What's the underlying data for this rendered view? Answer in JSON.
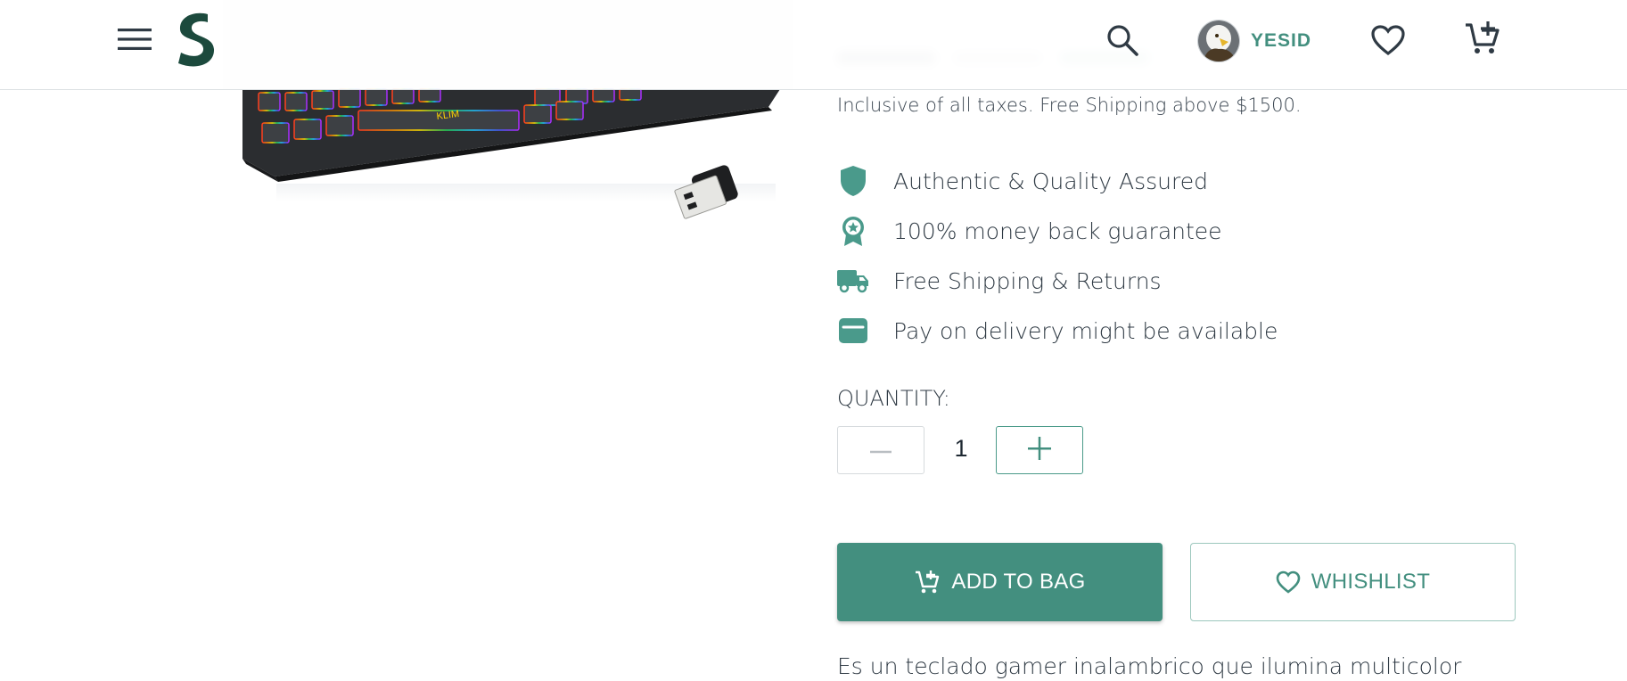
{
  "header": {
    "menu_icon": "hamburger-menu-icon",
    "logo_icon": "s-logo-icon",
    "search_icon": "search-icon",
    "username": "YESID",
    "wishlist_icon": "heart-icon",
    "cart_icon": "cart-add-icon"
  },
  "product": {
    "tax_note": "Inclusive of all taxes. Free Shipping above $1500.",
    "features": [
      {
        "icon": "shield-icon",
        "text": "Authentic & Quality Assured"
      },
      {
        "icon": "award-ribbon-icon",
        "text": "100% money back guarantee"
      },
      {
        "icon": "truck-icon",
        "text": "Free Shipping & Returns"
      },
      {
        "icon": "wallet-icon",
        "text": "Pay on delivery might be available"
      }
    ],
    "quantity_label": "QUANTITY:",
    "quantity_value": "1",
    "add_to_bag_label": "ADD TO BAG",
    "wishlist_label": "WHISHLIST",
    "description": "Es un teclado gamer inalambrico que ilumina multicolor"
  },
  "colors": {
    "accent": "#438f7f",
    "icon_teal": "#4a9a8b",
    "text": "#2f3a44"
  }
}
